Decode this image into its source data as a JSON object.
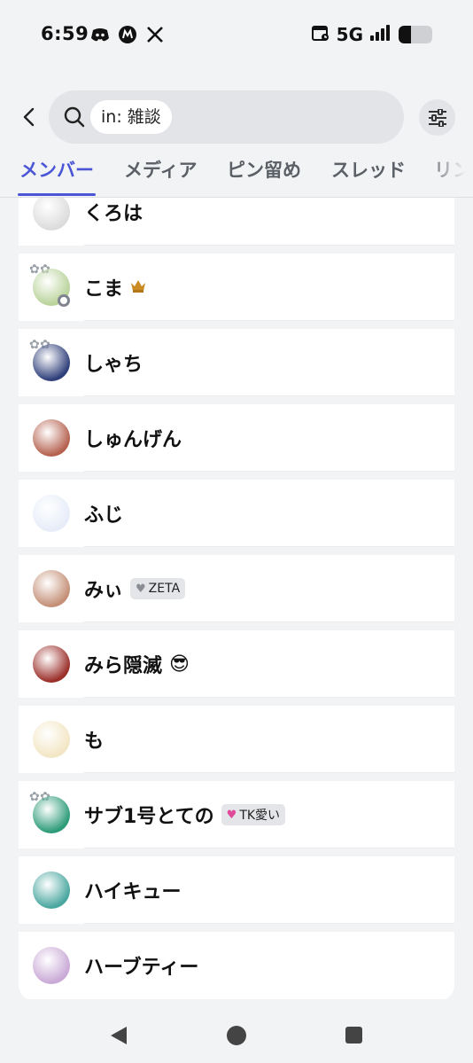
{
  "status_bar": {
    "time": "6:59",
    "network": "5G",
    "battery_level": 0.38,
    "app_icons": [
      "discord-icon",
      "misskey-icon",
      "x-icon"
    ]
  },
  "search": {
    "chip": "in: 雑談"
  },
  "tabs": [
    {
      "label": "メンバー",
      "active": true
    },
    {
      "label": "メディア",
      "active": false
    },
    {
      "label": "ピン留め",
      "active": false
    },
    {
      "label": "スレッド",
      "active": false
    },
    {
      "label": "リン",
      "active": false
    }
  ],
  "members": [
    {
      "name": "くろは",
      "avatar_color": "#dcdcdc"
    },
    {
      "name": "こま",
      "badge": "crown-icon",
      "avatar_color": "#b9d39a",
      "status": "offline"
    },
    {
      "name": "しゃち",
      "avatar_color": "#2f3f7a"
    },
    {
      "name": "しゅんげん",
      "avatar_color": "#b5614f"
    },
    {
      "name": "ふじ",
      "avatar_color": "#e6ecf8"
    },
    {
      "name": "みぃ",
      "tag": {
        "icon": "grey-heart-icon",
        "text": "ZETA"
      },
      "avatar_color": "#c48f76"
    },
    {
      "name": "みら隠滅",
      "emoji": "😎",
      "avatar_color": "#9b2f2a"
    },
    {
      "name": "も",
      "avatar_color": "#f3e6c4"
    },
    {
      "name": "サブ1号とての",
      "tag": {
        "icon": "pink-heart-icon",
        "text": "TK愛い"
      },
      "avatar_color": "#2c9b78"
    },
    {
      "name": "ハイキュー",
      "avatar_color": "#4aa7a0"
    },
    {
      "name": "ハーブティー",
      "avatar_color": "#c9a9d6"
    }
  ],
  "colors": {
    "accent": "#4a56d6",
    "background": "#f2f3f5"
  }
}
